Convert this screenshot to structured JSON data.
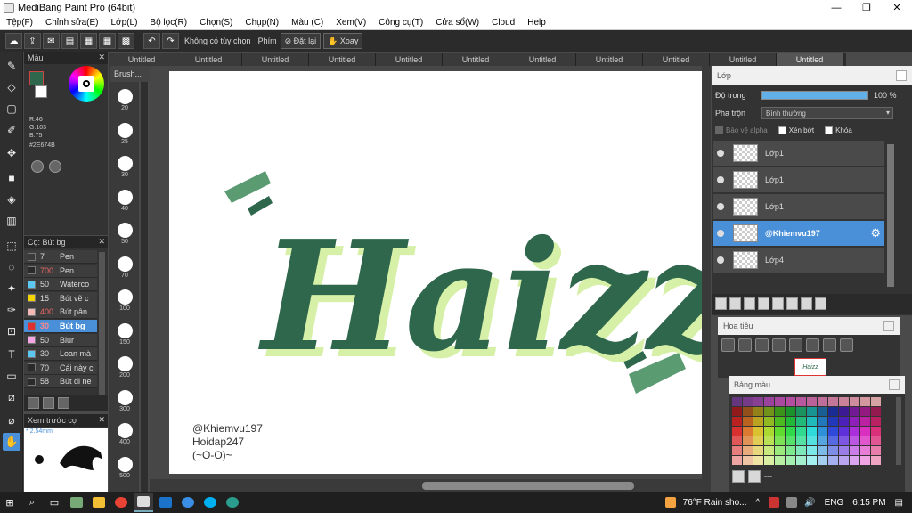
{
  "window": {
    "title": "MediBang Paint Pro (64bit)"
  },
  "menu": [
    "Tệp(F)",
    "Chỉnh sửa(E)",
    "Lớp(L)",
    "Bộ lọc(R)",
    "Chọn(S)",
    "Chụp(N)",
    "Màu (C)",
    "Xem(V)",
    "Công cụ(T)",
    "Cửa sổ(W)",
    "Cloud",
    "Help"
  ],
  "toolbar": {
    "no_option": "Không có tùy chọn",
    "keys_label": "Phím",
    "reset_label": "Đặt lại",
    "rotate_label": "Xoay"
  },
  "doc_tabs": [
    "Untitled",
    "Untitled",
    "Untitled",
    "Untitled",
    "Untitled",
    "Untitled",
    "Untitled",
    "Untitled",
    "Untitled",
    "Untitled",
    "Untitled"
  ],
  "color_panel": {
    "title": "Màu",
    "r": "R:46",
    "g": "G:103",
    "b": "B:75",
    "hex": "#2E674B",
    "fg_color": "#2E674B"
  },
  "brush_panel": {
    "tab": "Brush...",
    "sizes": [
      "20",
      "25",
      "30",
      "40",
      "50",
      "70",
      "100",
      "150",
      "200",
      "300",
      "400",
      "500"
    ]
  },
  "pen_panel": {
    "title": "Cọ: Bút bg",
    "rows": [
      {
        "size": "7",
        "name": "Pen",
        "color": "#3a3a3a"
      },
      {
        "size": "700",
        "name": "Pen",
        "color": "#2a2a2a",
        "size_color": "#e66"
      },
      {
        "size": "50",
        "name": "Waterco",
        "color": "#5ac8f0"
      },
      {
        "size": "15",
        "name": "Bút vẽ c",
        "color": "#f5d400"
      },
      {
        "size": "400",
        "name": "Bút pân",
        "color": "#f2b9b9",
        "size_color": "#e66"
      },
      {
        "size": "30",
        "name": "Bút bg",
        "color": "#e03030",
        "size_color": "#f88"
      },
      {
        "size": "50",
        "name": "Blur",
        "color": "#f4a6e4"
      },
      {
        "size": "30",
        "name": "Loan mà",
        "color": "#5ac8f0"
      },
      {
        "size": "70",
        "name": "Cái này c",
        "color": "#2a2a2a"
      },
      {
        "size": "58",
        "name": "Bút đi ne",
        "color": "#2a2a2a"
      }
    ],
    "selected_index": 5
  },
  "preview_panel": {
    "title": "Xem trước cọ",
    "size_tag": "* 2.54mm"
  },
  "canvas": {
    "lettering": "Haizz",
    "signature": [
      "@Khiemvu197",
      "Hoidap247",
      "(~O-O)~"
    ]
  },
  "layer_panel": {
    "title": "Lớp",
    "opacity_label": "Độ trong",
    "opacity_value": "100 %",
    "opacity": 1.0,
    "blend_label": "Pha trộn",
    "blend_value": "Bình thường",
    "protect_alpha": "Bảo vệ alpha",
    "clipping": "Xén bớt",
    "lock": "Khóa",
    "layers": [
      "Lớp1",
      "Lớp1",
      "Lớp1",
      "@Khiemvu197",
      "Lớp4"
    ],
    "selected_index": 3
  },
  "navigator": {
    "title": "Hoa tiêu",
    "thumb_text": "Haizz"
  },
  "palette": {
    "title": "Bảng màu",
    "footer": "---"
  },
  "taskbar": {
    "weather": "76°F  Rain sho...",
    "lang": "ENG",
    "time": "6:15 PM"
  }
}
